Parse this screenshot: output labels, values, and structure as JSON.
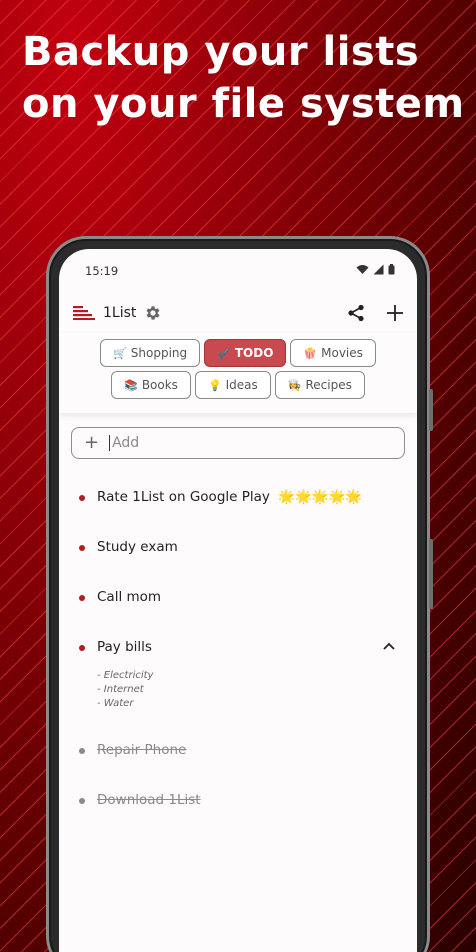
{
  "promo": {
    "line1": "Backup your lists",
    "line2": "on your file system"
  },
  "status": {
    "time": "15:19"
  },
  "app": {
    "title": "1List",
    "menu_icon": "list-menu-icon",
    "settings_icon": "gear-icon"
  },
  "actions": {
    "share_icon": "share-icon",
    "add_icon": "plus-icon"
  },
  "tabs_row1": [
    {
      "emoji": "🛒",
      "label": "Shopping",
      "active": false
    },
    {
      "emoji": "✔️",
      "label": "TODO",
      "active": true
    },
    {
      "emoji": "🍿",
      "label": "Movies",
      "active": false
    }
  ],
  "tabs_row2": [
    {
      "emoji": "📚",
      "label": "Books",
      "active": false
    },
    {
      "emoji": "💡",
      "label": "Ideas",
      "active": false
    },
    {
      "emoji": "👩‍🍳",
      "label": "Recipes",
      "active": false
    }
  ],
  "add": {
    "placeholder": "Add"
  },
  "items": [
    {
      "text": "Rate 1List on Google Play",
      "stars": "🌟🌟🌟🌟🌟",
      "done": false
    },
    {
      "text": "Study exam",
      "done": false
    },
    {
      "text": "Call mom",
      "done": false
    },
    {
      "text": "Pay bills",
      "done": false,
      "expanded": true,
      "notes": [
        "- Electricity",
        "- Internet",
        "- Water"
      ]
    },
    {
      "text": "Repair Phone",
      "done": true
    },
    {
      "text": "Download 1List",
      "done": true
    }
  ],
  "colors": {
    "accent": "#c9494f",
    "brand_red": "#b01c22",
    "background_red": "#8e0008"
  }
}
